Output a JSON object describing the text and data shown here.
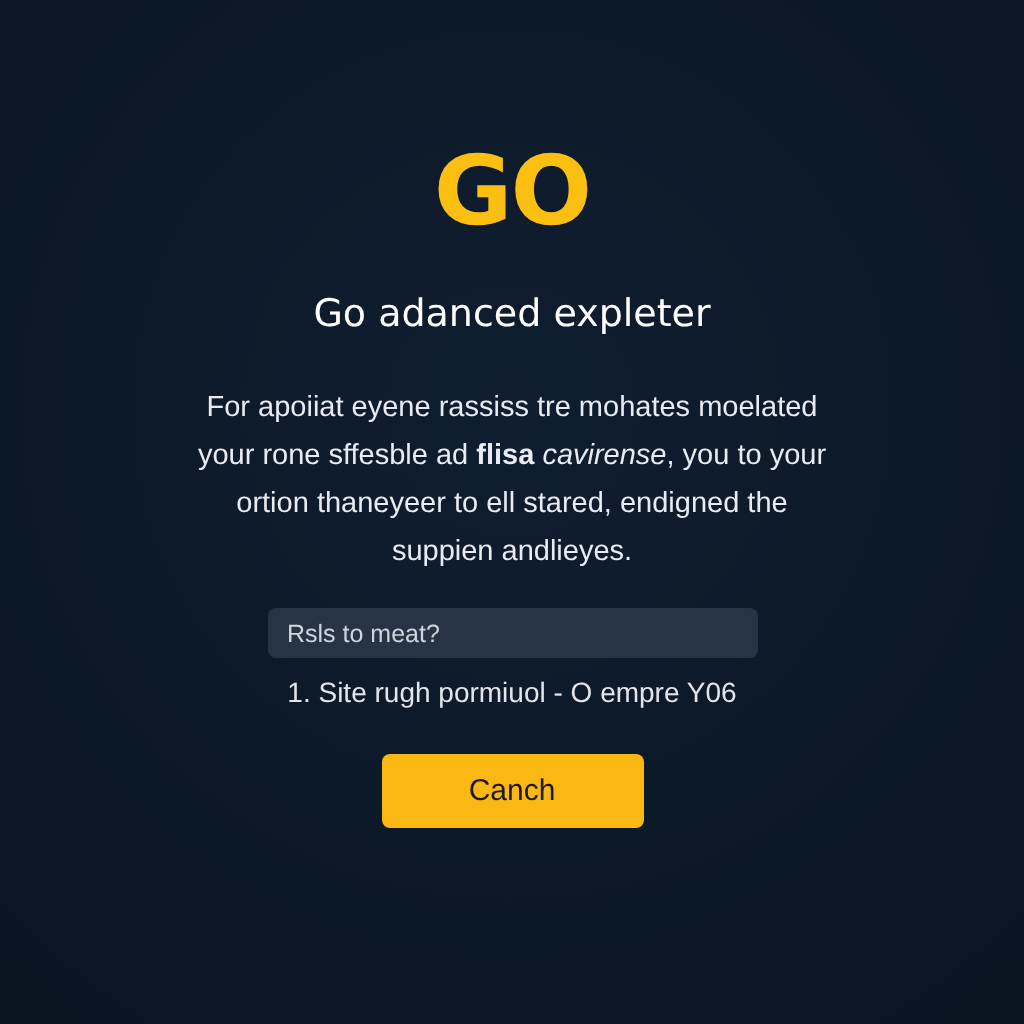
{
  "logo": "GO",
  "title": "Go adanced expleter",
  "description": "For apoiiat eyene rassiss tre mohates moelated your rone sffesble ad **flisa** *cavirense*, you to your ortion thaneyeer to ell stared, endigned the suppien andlieyes.",
  "field": {
    "placeholder": "Rsls to meat?"
  },
  "note": "1. Site rugh pormiuol - O empre Y06",
  "button": "Canch"
}
